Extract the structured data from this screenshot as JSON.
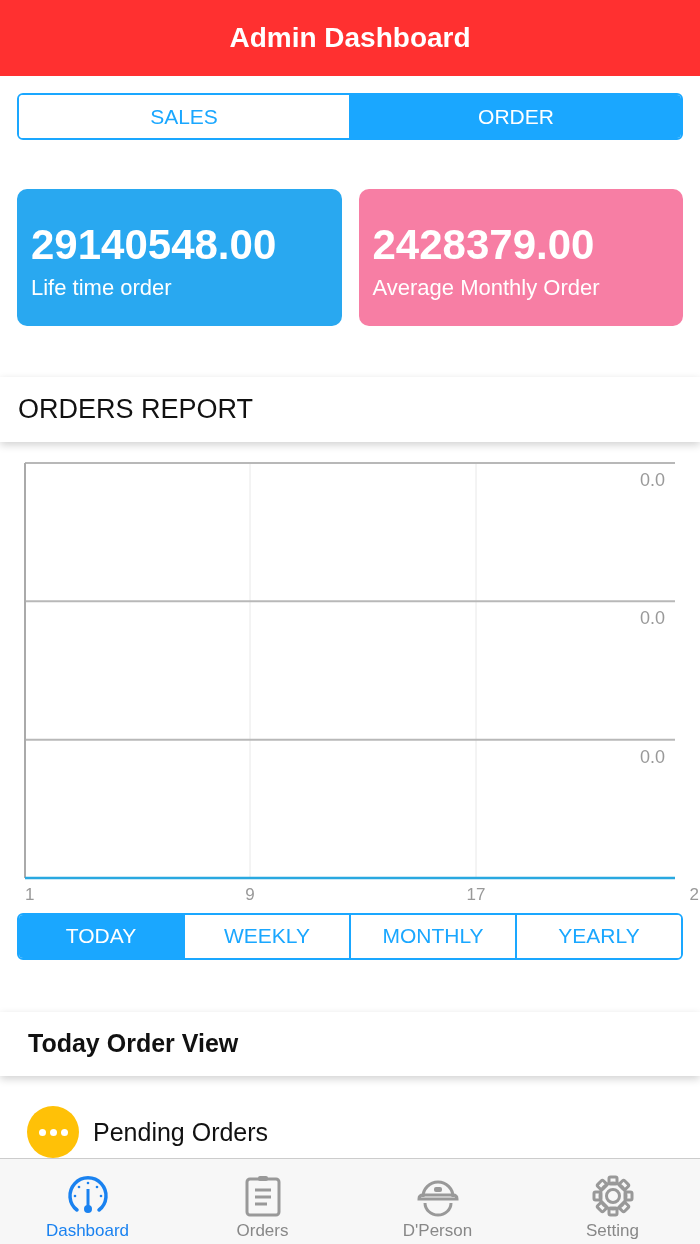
{
  "header": {
    "title": "Admin Dashboard"
  },
  "mode_tabs": [
    {
      "label": "SALES",
      "selected": false
    },
    {
      "label": "ORDER",
      "selected": true
    }
  ],
  "stats": [
    {
      "value": "29140548.00",
      "label": "Life time order",
      "color": "#29a8f0"
    },
    {
      "value": "2428379.00",
      "label": "Average Monthly Order",
      "color": "#f77ea4"
    }
  ],
  "orders_report": {
    "title": "ORDERS REPORT",
    "y_labels": [
      "0.0",
      "0.0",
      "0.0"
    ],
    "x_labels": [
      "1",
      "9",
      "17",
      "2"
    ]
  },
  "period_tabs": [
    {
      "label": "TODAY",
      "selected": true
    },
    {
      "label": "WEEKLY",
      "selected": false
    },
    {
      "label": "MONTHLY",
      "selected": false
    },
    {
      "label": "YEARLY",
      "selected": false
    }
  ],
  "today_view": {
    "title": "Today Order View",
    "items": [
      {
        "label": "Pending Orders",
        "color": "#ffc107"
      }
    ]
  },
  "tab_bar": [
    {
      "label": "Dashboard",
      "selected": true
    },
    {
      "label": "Orders",
      "selected": false
    },
    {
      "label": "D'Person",
      "selected": false
    },
    {
      "label": "Setting",
      "selected": false
    }
  ]
}
